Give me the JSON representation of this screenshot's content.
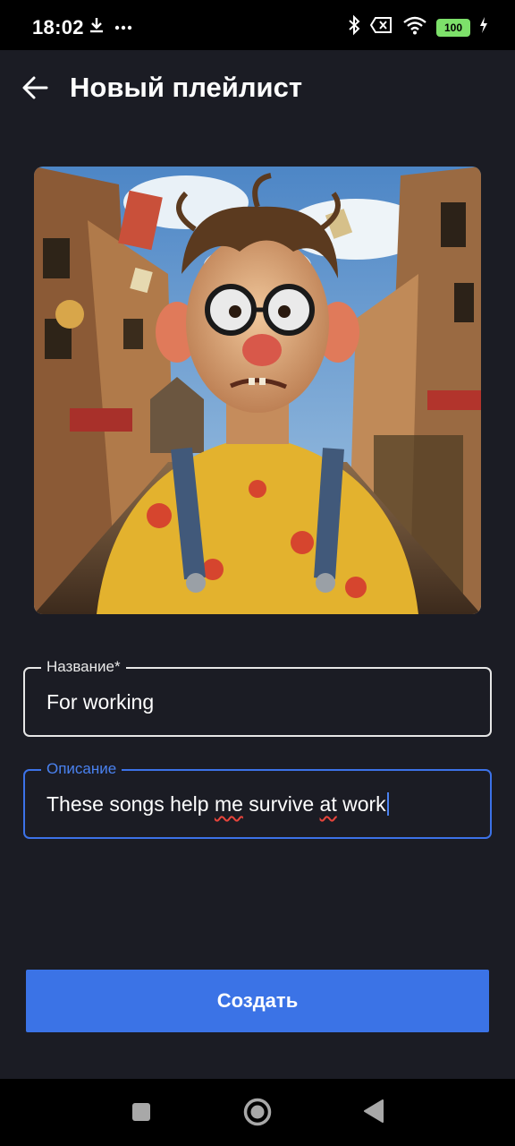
{
  "status_bar": {
    "time": "18:02",
    "left_icons": [
      "download-icon",
      "more-dots-icon"
    ],
    "right_icons": [
      "bluetooth-icon",
      "sim-x-icon",
      "wifi-icon",
      "battery-icon",
      "charging-icon"
    ],
    "battery_level": "100",
    "battery_color": "#7de06a"
  },
  "header": {
    "title": "Новый плейлист",
    "back_icon": "arrow-left-icon"
  },
  "cover": {
    "description_icon": "playlist-cover-image"
  },
  "form": {
    "name_label": "Название*",
    "name_value": "For working",
    "description_label": "Описание",
    "description_parts": [
      "These songs help ",
      "me",
      " survive ",
      "at",
      " work"
    ]
  },
  "actions": {
    "create_label": "Создать"
  },
  "colors": {
    "background": "#1b1c24",
    "accent": "#3b73e6",
    "focus_border": "#3c72e8",
    "spellcheck": "#e8453c"
  },
  "nav": {
    "buttons": [
      "recents-square-icon",
      "home-circle-icon",
      "back-triangle-icon"
    ]
  }
}
